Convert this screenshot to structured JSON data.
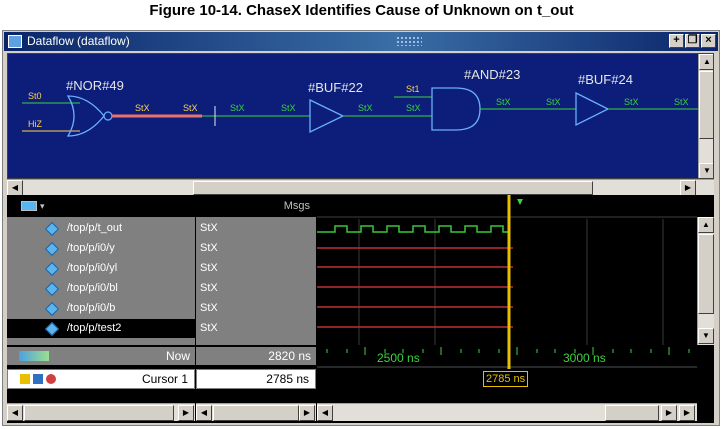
{
  "figure_caption": "Figure 10-14. ChaseX Identifies Cause of Unknown on t_out",
  "window": {
    "title": "Dataflow (dataflow)"
  },
  "schematic": {
    "gates": [
      "#NOR#49",
      "#BUF#22",
      "#AND#23",
      "#BUF#24"
    ],
    "inputs": {
      "nor_a": "St0",
      "nor_b": "HiZ",
      "and_a": "St1"
    },
    "wire_value": "StX"
  },
  "wave": {
    "messages_header": "Msgs",
    "signals": [
      {
        "name": "/top/p/t_out",
        "value": "StX"
      },
      {
        "name": "/top/p/i0/y",
        "value": "StX"
      },
      {
        "name": "/top/p/i0/yl",
        "value": "StX"
      },
      {
        "name": "/top/p/i0/bl",
        "value": "StX"
      },
      {
        "name": "/top/p/i0/b",
        "value": "StX"
      },
      {
        "name": "/top/p/test2",
        "value": "StX"
      }
    ],
    "now_label": "Now",
    "now_value": "2820 ns",
    "cursor_label": "Cursor 1",
    "cursor_value": "2785 ns",
    "timeline_ticks": [
      "2500 ns",
      "3000 ns"
    ],
    "cursor_flag": "2785 ns"
  },
  "colors": {
    "bus_x": "#e8736e",
    "wire": "#3cd23c",
    "cursor": "#e8c000",
    "signal_high": "#35c935"
  }
}
